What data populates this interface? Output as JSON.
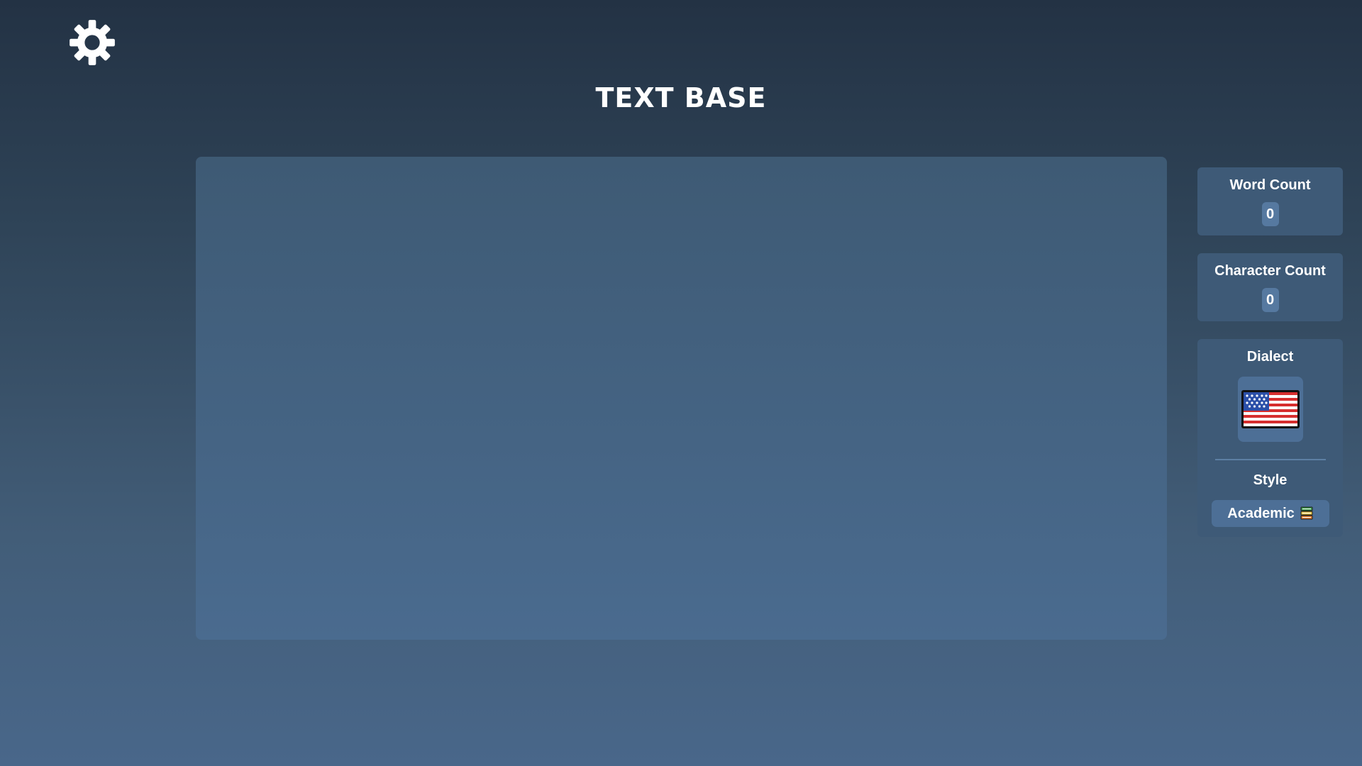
{
  "app": {
    "title": "TEXT BASE"
  },
  "header": {
    "settings_icon": "gear-icon"
  },
  "editor": {
    "value": "",
    "placeholder": ""
  },
  "stats": {
    "word_count_label": "Word Count",
    "word_count_value": "0",
    "char_count_label": "Character Count",
    "char_count_value": "0"
  },
  "dialect": {
    "label": "Dialect",
    "selected_icon": "us-flag-icon"
  },
  "style": {
    "label": "Style",
    "selected": "Academic",
    "icon": "books-icon"
  },
  "colors": {
    "background_top": "#233244",
    "background_bottom": "#49678a",
    "panel": "#3e5a77",
    "badge": "#5679a0",
    "text": "#ffffff"
  }
}
